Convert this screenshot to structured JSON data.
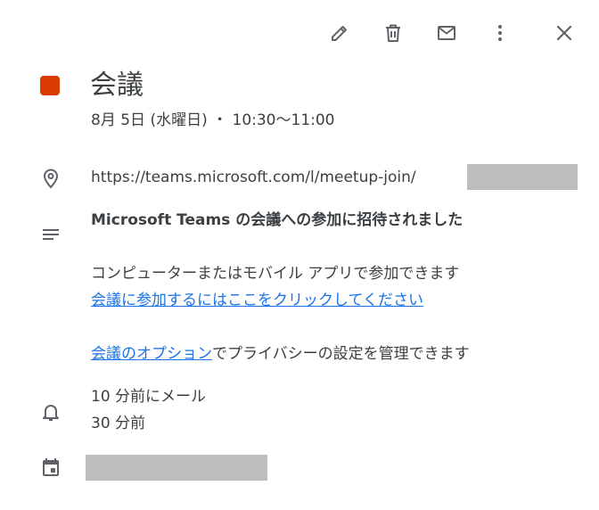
{
  "toolbar": {
    "edit_icon": "pencil-icon",
    "delete_icon": "trash-icon",
    "mail_icon": "mail-icon",
    "more_icon": "more-vert-icon",
    "close_icon": "close-icon"
  },
  "event": {
    "color": "#d93a00",
    "title": "会議",
    "datetime": "8月 5日 (水曜日) ・ 10:30～11:00",
    "location_prefix": "https://teams.microsoft.com/l/meetup-join/",
    "location_redacted": true
  },
  "description": {
    "heading": "Microsoft Teams の会議への参加に招待されました",
    "line1": "コンピューターまたはモバイル アプリで参加できます",
    "join_link": "会議に参加するにはここをクリックしてください",
    "options_link": "会議のオプション",
    "options_suffix": "でプライバシーの設定を管理できます"
  },
  "reminders": [
    "10 分前にメール",
    "30 分前"
  ],
  "calendar": {
    "name_redacted": true
  },
  "colors": {
    "icon": "#5f6368",
    "text": "#3c4043",
    "link": "#1a73e8",
    "redaction": "#bdbdbd"
  }
}
